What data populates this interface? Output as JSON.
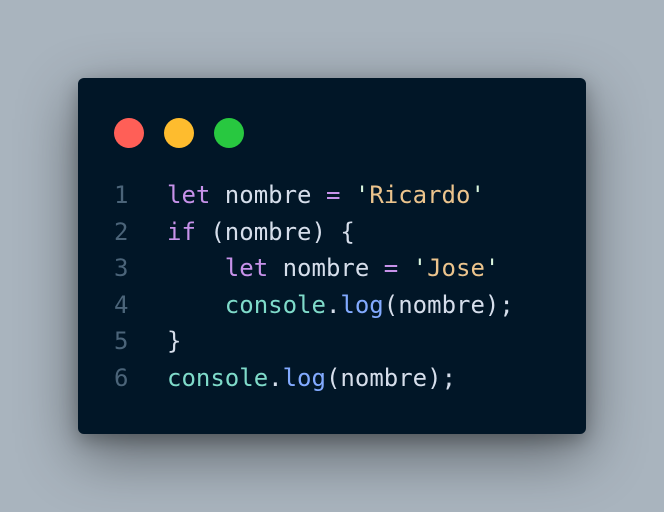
{
  "window": {
    "controls": [
      {
        "name": "close",
        "color": "#ff5f57"
      },
      {
        "name": "minimize",
        "color": "#febc2e"
      },
      {
        "name": "maximize",
        "color": "#28c840"
      }
    ]
  },
  "code": {
    "language": "javascript",
    "lines": [
      {
        "number": "1",
        "tokens": [
          {
            "t": "kw",
            "v": "let"
          },
          {
            "t": "id",
            "v": " nombre "
          },
          {
            "t": "op",
            "v": "="
          },
          {
            "t": "id",
            "v": " "
          },
          {
            "t": "str-q",
            "v": "'"
          },
          {
            "t": "str",
            "v": "Ricardo"
          },
          {
            "t": "str-q",
            "v": "'"
          }
        ]
      },
      {
        "number": "2",
        "tokens": [
          {
            "t": "kw",
            "v": "if"
          },
          {
            "t": "punc",
            "v": " (nombre) {"
          }
        ]
      },
      {
        "number": "3",
        "tokens": [
          {
            "t": "id",
            "v": "    "
          },
          {
            "t": "kw",
            "v": "let"
          },
          {
            "t": "id",
            "v": " nombre "
          },
          {
            "t": "op",
            "v": "="
          },
          {
            "t": "id",
            "v": " "
          },
          {
            "t": "str-q",
            "v": "'"
          },
          {
            "t": "str",
            "v": "Jose"
          },
          {
            "t": "str-q",
            "v": "'"
          }
        ]
      },
      {
        "number": "4",
        "tokens": [
          {
            "t": "id",
            "v": "    "
          },
          {
            "t": "obj",
            "v": "console"
          },
          {
            "t": "punc",
            "v": "."
          },
          {
            "t": "fn",
            "v": "log"
          },
          {
            "t": "punc",
            "v": "(nombre);"
          }
        ]
      },
      {
        "number": "5",
        "tokens": [
          {
            "t": "punc",
            "v": "}"
          }
        ]
      },
      {
        "number": "6",
        "tokens": [
          {
            "t": "obj",
            "v": "console"
          },
          {
            "t": "punc",
            "v": "."
          },
          {
            "t": "fn",
            "v": "log"
          },
          {
            "t": "punc",
            "v": "(nombre);"
          }
        ]
      }
    ]
  }
}
